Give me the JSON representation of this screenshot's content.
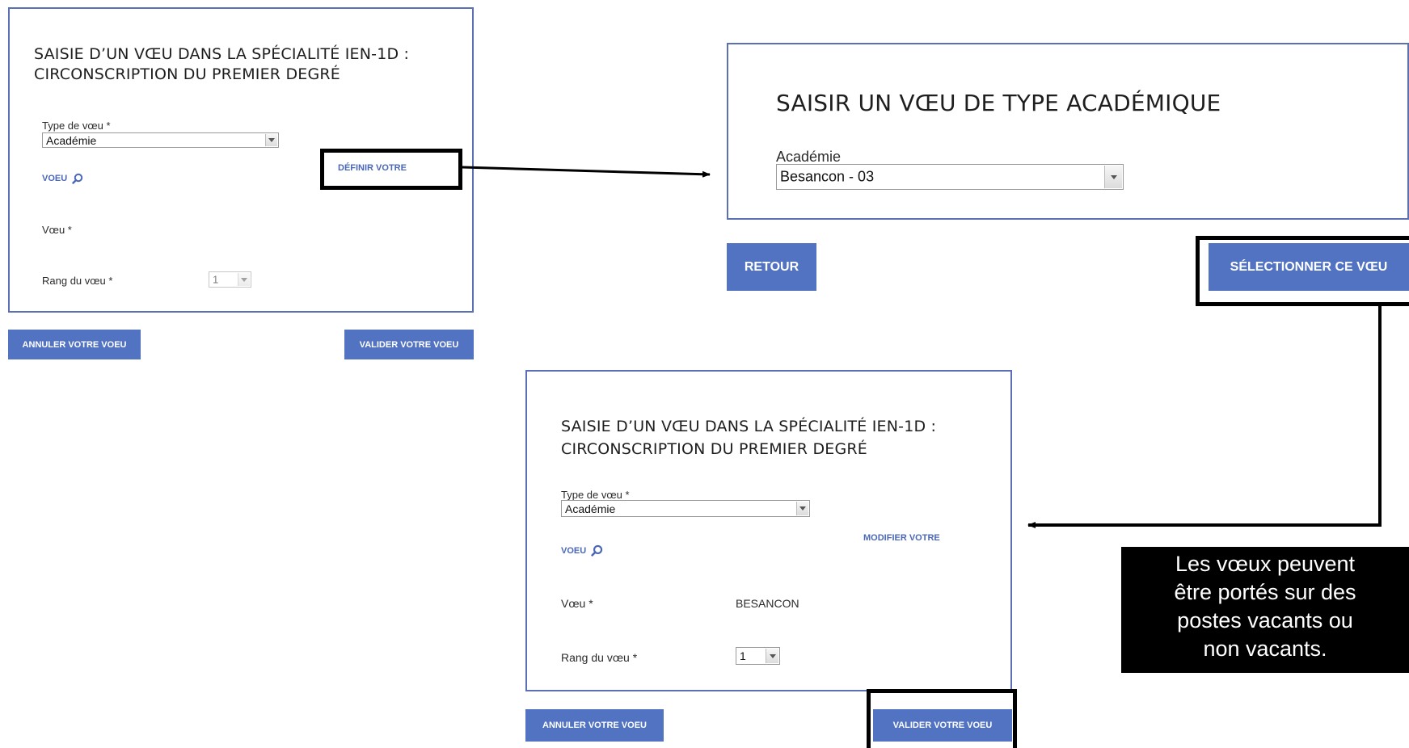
{
  "left_panel": {
    "title_line1": "SAISIE D’UN VŒU DANS LA SPÉCIALITÉ IEN-1D :",
    "title_line2": "CIRCONSCRIPTION DU PREMIER DEGRÉ",
    "type_label": "Type de vœu *",
    "type_value": "Académie",
    "define_link": "DÉFINIR VOTRE",
    "voeu_link": "VOEU",
    "voeu_label": "Vœu *",
    "rank_label": "Rang du vœu *",
    "rank_value": "1",
    "cancel_button": "ANNULER VOTRE VOEU",
    "validate_button": "VALIDER VOTRE VOEU"
  },
  "dialog": {
    "title": "SAISIR UN VŒU DE TYPE ACADÉMIQUE",
    "academie_label": "Académie",
    "academie_value": "Besancon - 03",
    "back_button": "RETOUR",
    "select_button": "SÉLECTIONNER CE VŒU"
  },
  "bottom_panel": {
    "title_line1": "SAISIE D’UN VŒU DANS LA SPÉCIALITÉ IEN-1D :",
    "title_line2": "CIRCONSCRIPTION DU PREMIER DEGRÉ",
    "type_label": "Type de vœu *",
    "type_value": "Académie",
    "modify_link": "MODIFIER VOTRE",
    "voeu_link": "VOEU",
    "voeu_label": "Vœu *",
    "voeu_value": "BESANCON",
    "rank_label": "Rang du vœu *",
    "rank_value": "1",
    "cancel_button": "ANNULER VOTRE VOEU",
    "validate_button": "VALIDER VOTRE VOEU"
  },
  "note": {
    "line1": "Les vœux peuvent",
    "line2": "être portés sur des",
    "line3": "postes vacants ou",
    "line4": "non vacants."
  },
  "colors": {
    "accent": "#5273c1",
    "panel_border": "#5a6fb4",
    "highlight": "#000000"
  },
  "icons": [
    "search-icon",
    "chevron-down-icon",
    "arrow-right-icon",
    "arrow-left-icon"
  ]
}
